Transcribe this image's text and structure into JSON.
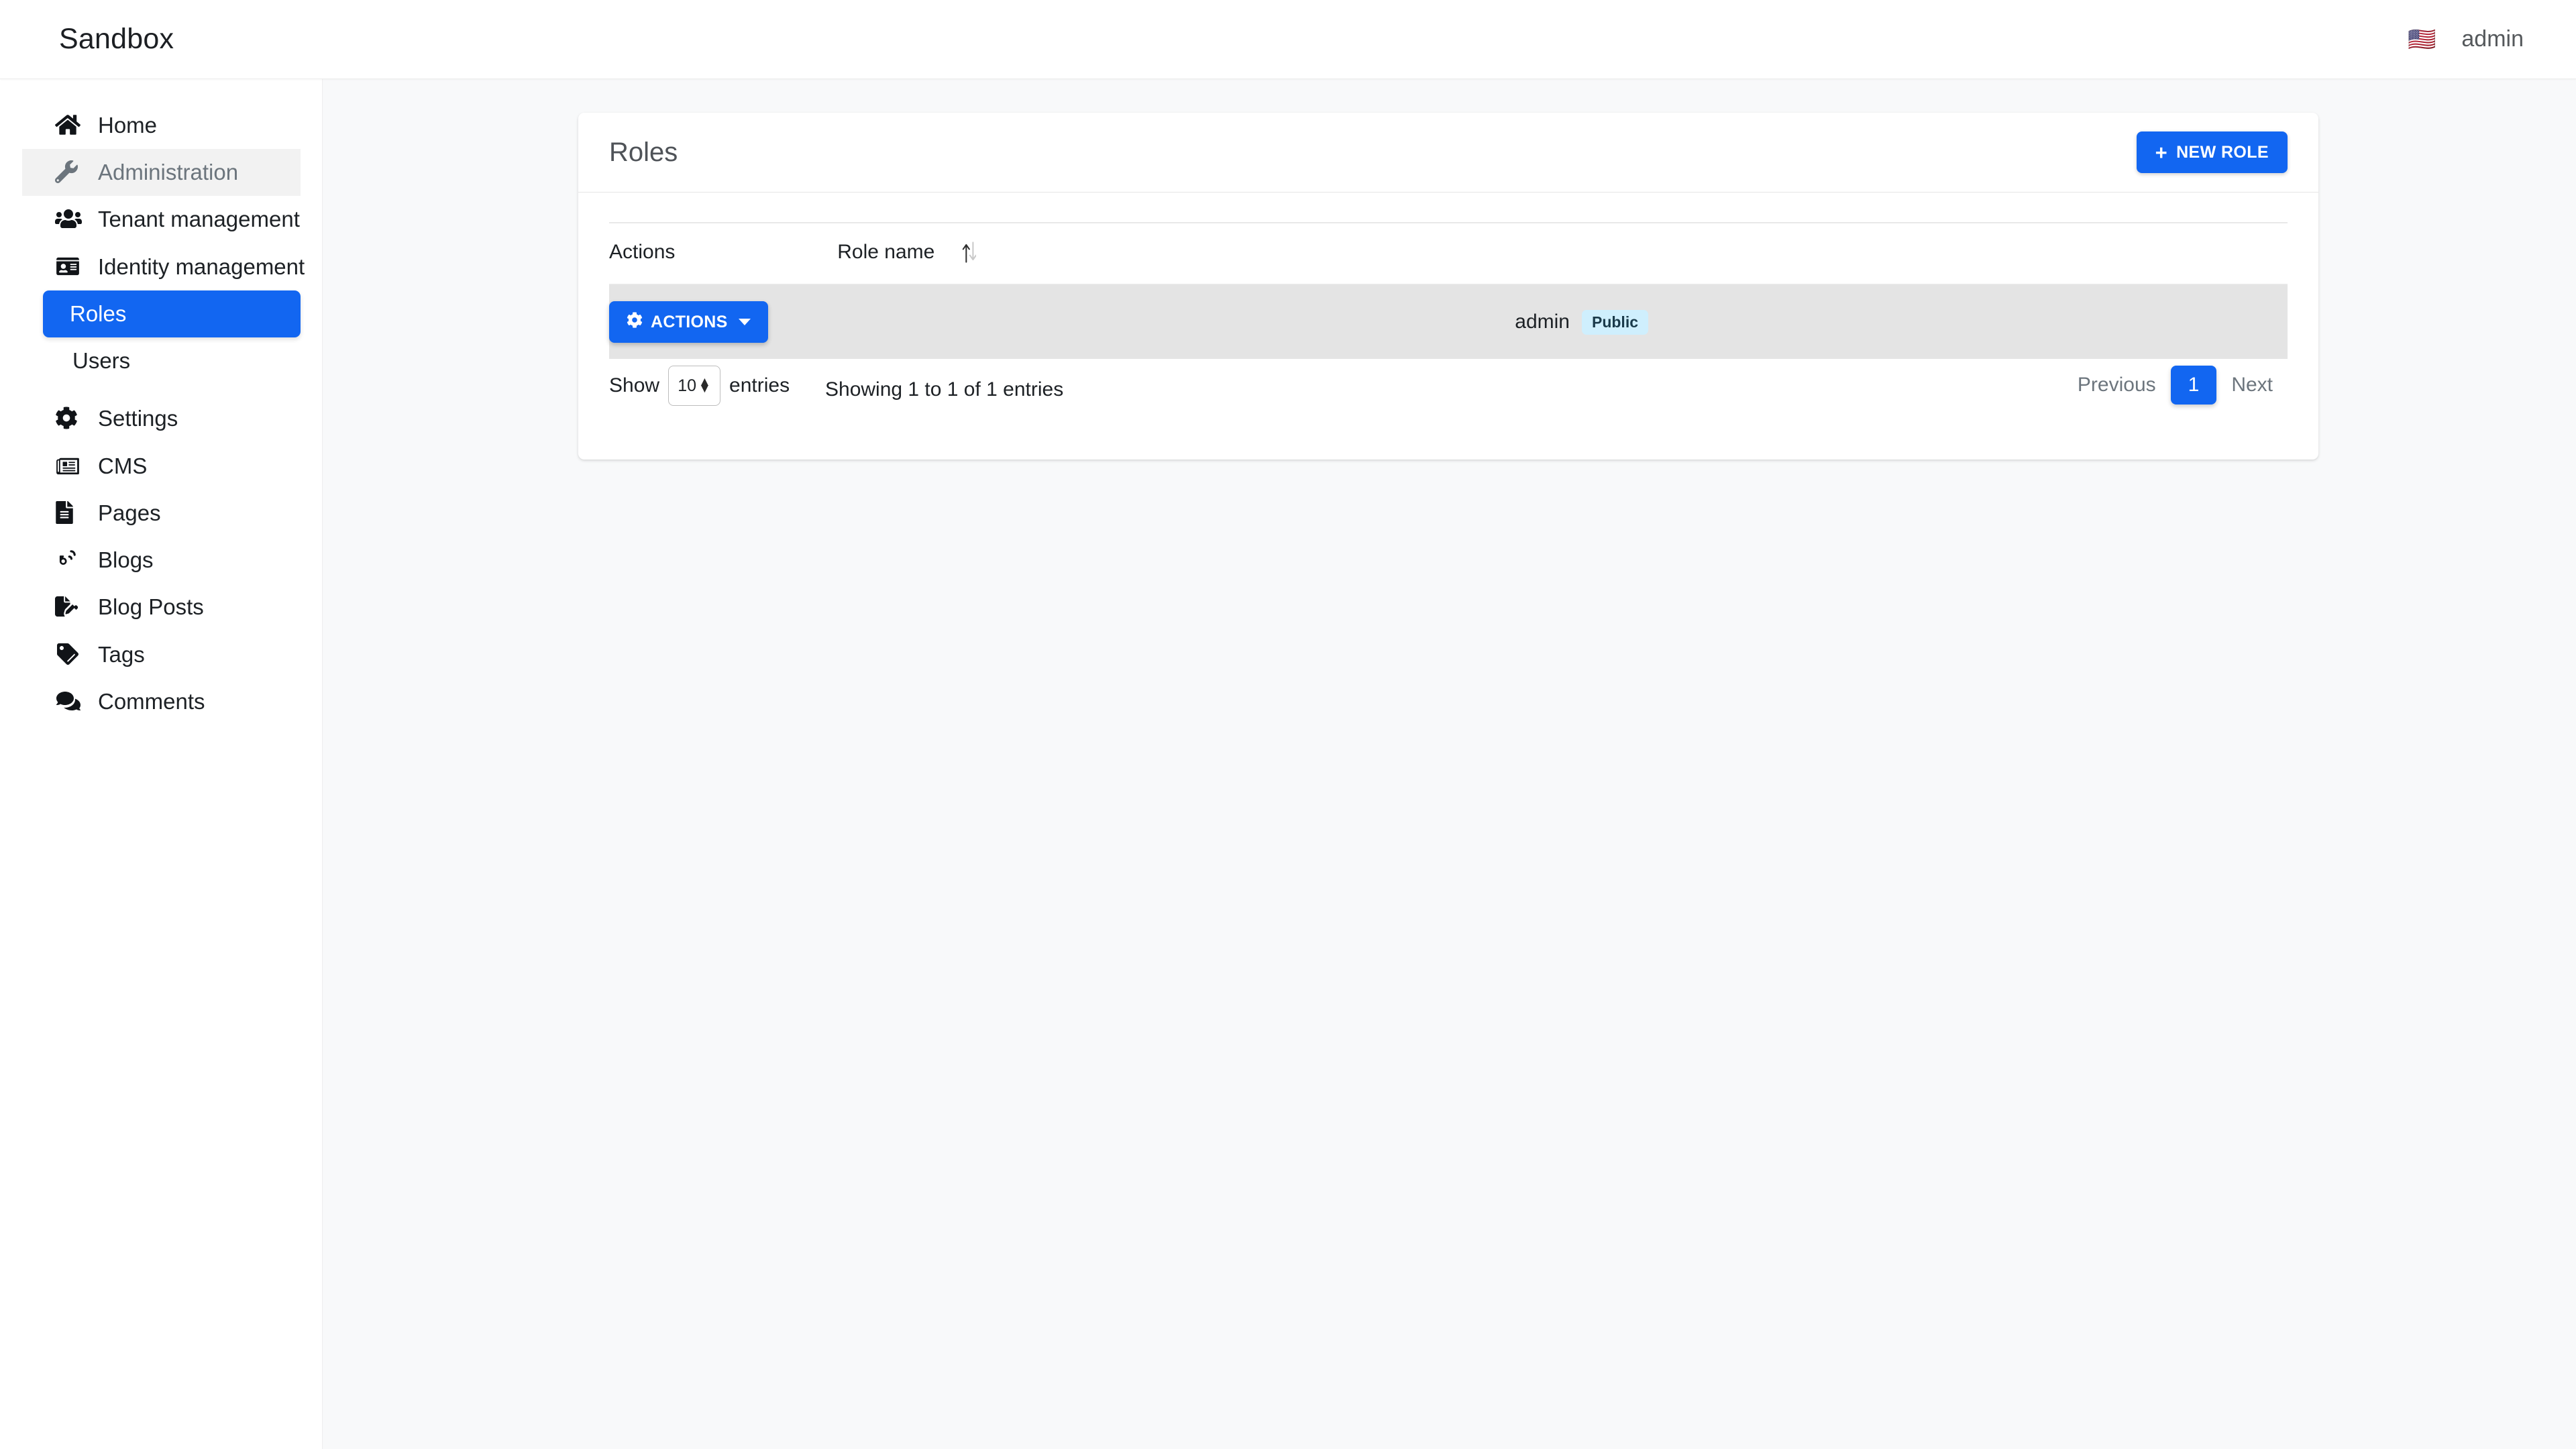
{
  "navbar": {
    "brand": "Sandbox",
    "flag_icon": "us-flag-icon",
    "flag_glyph": "🇺🇸",
    "user": "admin"
  },
  "sidebar": {
    "items": [
      {
        "label": "Home",
        "icon": "home-icon",
        "state": "default"
      },
      {
        "label": "Administration",
        "icon": "wrench-icon",
        "state": "band"
      },
      {
        "label": "Tenant management",
        "icon": "users-icon",
        "state": "default"
      },
      {
        "label": "Identity management",
        "icon": "id-card-icon",
        "state": "default"
      },
      {
        "label": "Roles",
        "icon": "none",
        "state": "active"
      },
      {
        "label": "Users",
        "icon": "none",
        "state": "sub"
      },
      {
        "label": "Settings",
        "icon": "gear-icon",
        "state": "default"
      },
      {
        "label": "CMS",
        "icon": "newspaper-icon",
        "state": "default"
      },
      {
        "label": "Pages",
        "icon": "file-icon",
        "state": "default"
      },
      {
        "label": "Blogs",
        "icon": "blog-icon",
        "state": "default"
      },
      {
        "label": "Blog Posts",
        "icon": "file-pen-icon",
        "state": "default"
      },
      {
        "label": "Tags",
        "icon": "tag-icon",
        "state": "default"
      },
      {
        "label": "Comments",
        "icon": "comments-icon",
        "state": "default"
      }
    ]
  },
  "card": {
    "title": "Roles",
    "new_button": {
      "label": "NEW ROLE",
      "plus": "+",
      "icon": "plus-icon"
    }
  },
  "table": {
    "columns": [
      "Actions",
      "Role name"
    ],
    "sort_icon": "sort-arrows-icon",
    "rows": [
      {
        "actions_label": "ACTIONS",
        "actions_icon": "gear-icon",
        "role_name": "admin",
        "badge": "Public"
      }
    ]
  },
  "footer": {
    "show_label": "Show",
    "page_length": "10",
    "entries_label": "entries",
    "info": "Showing 1 to 1 of 1 entries",
    "pagination": {
      "previous": "Previous",
      "current": "1",
      "next": "Next"
    }
  },
  "colors": {
    "accent_blue": "#1266f1",
    "row_gray": "#e4e4e4",
    "badge_blue": "#cfeffd",
    "page_bg": "#f8f9fa"
  }
}
